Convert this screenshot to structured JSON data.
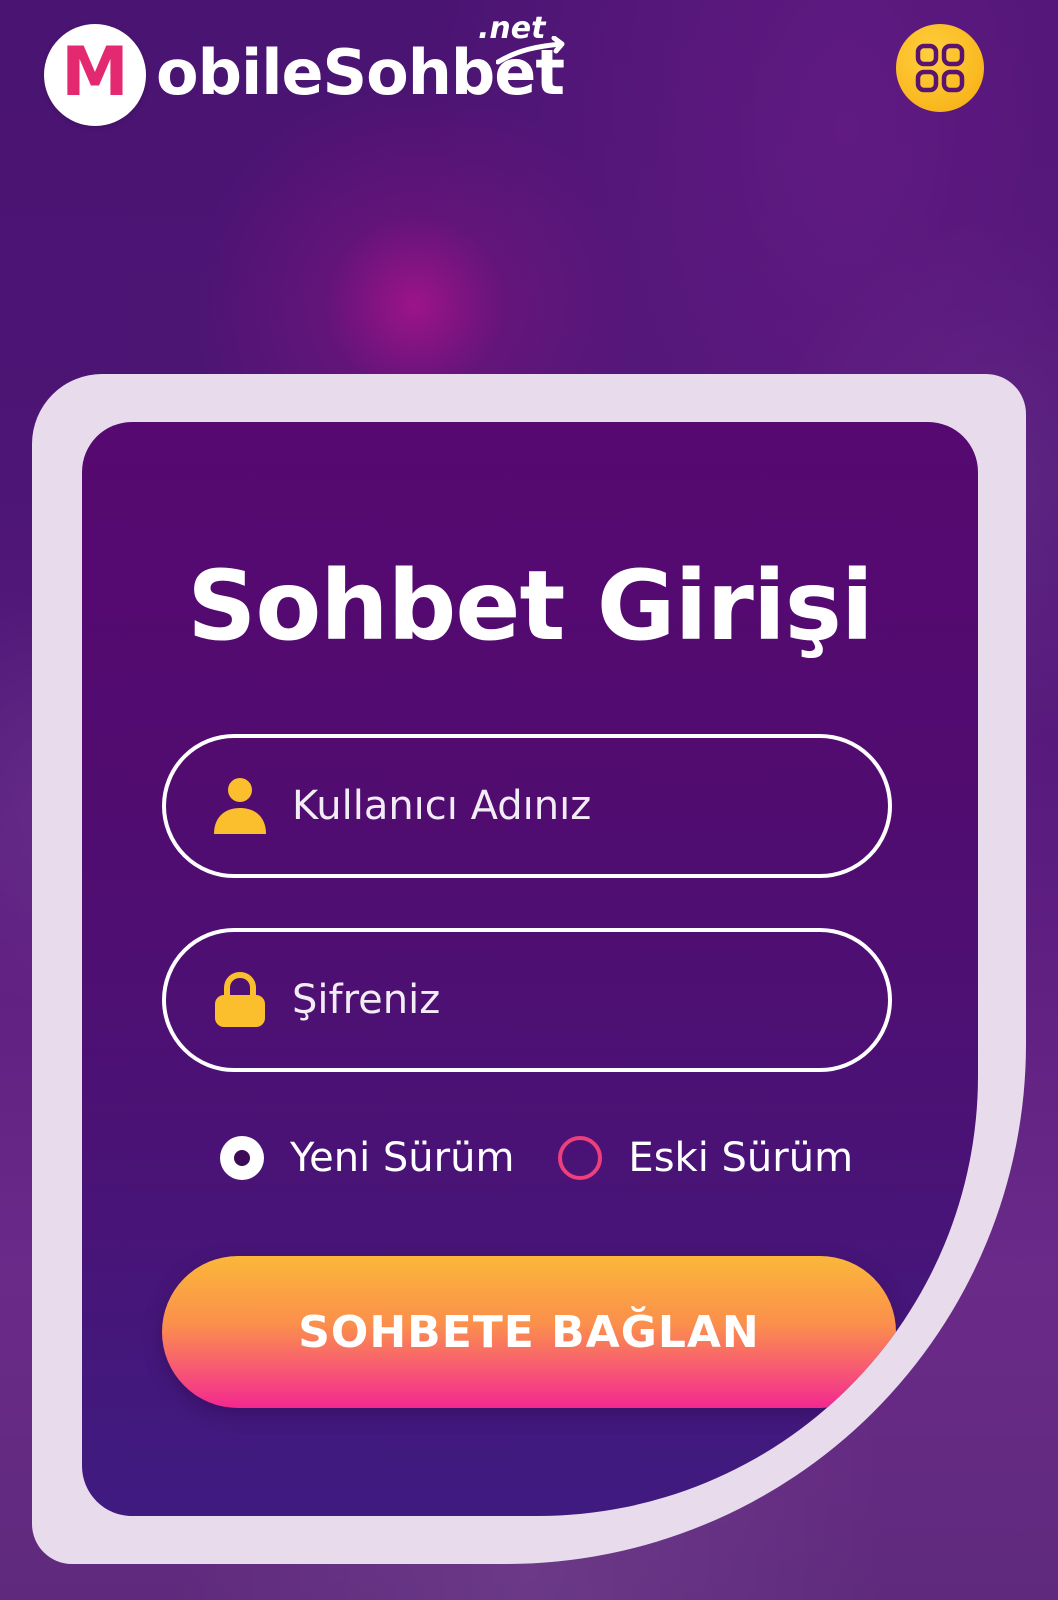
{
  "header": {
    "logo_letter": "M",
    "logo_text": "obileSohbet",
    "logo_tld": ".net",
    "menu_icon": "grid-icon"
  },
  "login": {
    "title": "Sohbet Girişi",
    "username": {
      "placeholder": "Kullanıcı Adınız",
      "value": "",
      "icon": "user-icon"
    },
    "password": {
      "placeholder": "Şifreniz",
      "value": "",
      "icon": "lock-icon"
    },
    "versions": {
      "options": [
        {
          "label": "Yeni Sürüm",
          "selected": true
        },
        {
          "label": "Eski Sürüm",
          "selected": false
        }
      ]
    },
    "submit_label": "SOHBETE BAĞLAN"
  },
  "colors": {
    "accent_yellow": "#f9b71e",
    "accent_pink": "#ec3f7c",
    "card_purple": "#510c70",
    "card_frame": "#e8dcec"
  }
}
